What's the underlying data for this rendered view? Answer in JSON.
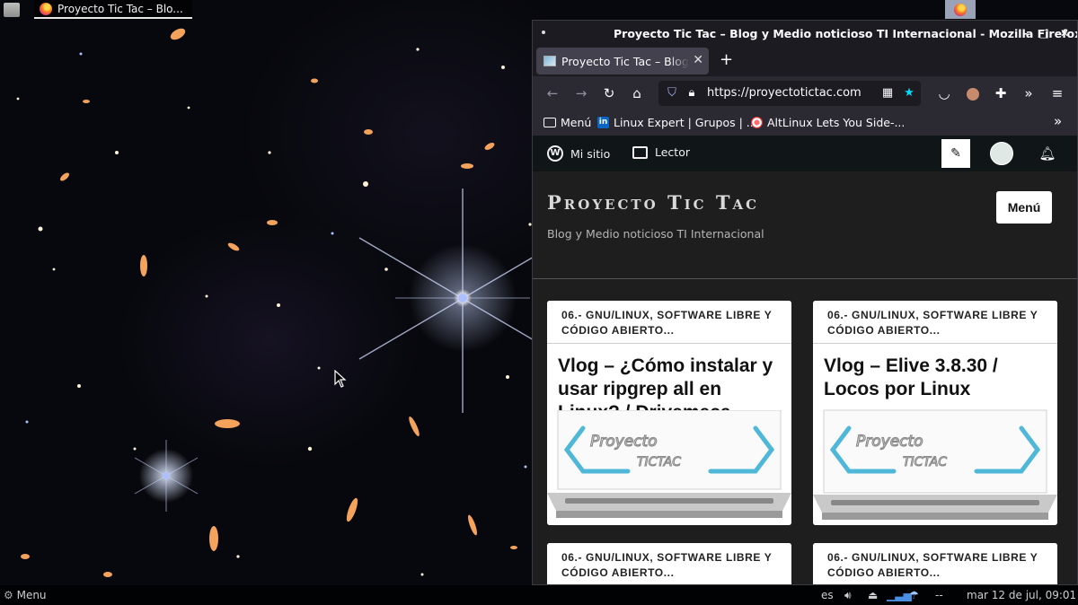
{
  "top_panel": {
    "task_label": "Proyecto Tic Tac – Blo..."
  },
  "window": {
    "title": "Proyecto Tic Tac – Blog y Medio noticioso TI Internacional - Mozilla Firefox",
    "tab_label": "Proyecto Tic Tac – Blog y Medio noticioso TI Internacional",
    "url": "https://proyectotictac.com",
    "bookmarks": [
      {
        "label": "Menú"
      },
      {
        "label": "Linux Expert | Grupos | ..."
      },
      {
        "label": "AltLinux Lets You Side-..."
      }
    ]
  },
  "wp_bar": {
    "my_site": "Mi sitio",
    "reader": "Lector"
  },
  "site": {
    "title": "Proyecto Tic Tac",
    "tagline": "Blog y Medio noticioso TI Internacional",
    "menu_label": "Menú"
  },
  "cards": [
    {
      "category": "06.- GNU/LINUX, SOFTWARE LIBRE Y CÓDIGO ABIERTO...",
      "title": "Vlog – ¿Cómo instalar y usar ripgrep all en Linux? / Drivemeca",
      "image_text": [
        "Proyecto",
        "TICTAC"
      ]
    },
    {
      "category": "06.- GNU/LINUX, SOFTWARE LIBRE Y CÓDIGO ABIERTO...",
      "title": "Vlog – Elive 3.8.30 / Locos por Linux",
      "image_text": [
        "Proyecto",
        "TICTAC"
      ]
    },
    {
      "category": "06.- GNU/LINUX, SOFTWARE LIBRE Y CÓDIGO ABIERTO...",
      "title": ""
    },
    {
      "category": "06.- GNU/LINUX, SOFTWARE LIBRE Y CÓDIGO ABIERTO...",
      "title": ""
    }
  ],
  "bottom_panel": {
    "menu_label": "Menu",
    "keyboard_layout": "es",
    "weather": "--",
    "clock": "mar 12 de jul, 09:01"
  },
  "colors": {
    "firefox_dark": "#1c1b22",
    "toolbar": "#2b2a33",
    "wp_bar": "#101517",
    "page_bg": "#1e1e1e",
    "bookmark_star": "#00ddff",
    "brand_cyan": "#4fb8d8"
  }
}
